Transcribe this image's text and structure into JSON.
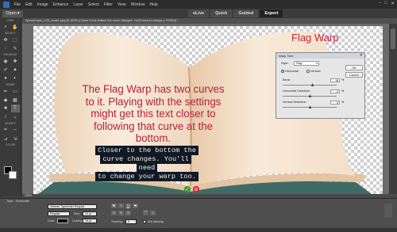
{
  "menu": {
    "items": [
      "File",
      "Edit",
      "Image",
      "Enhance",
      "Layer",
      "Select",
      "Filter",
      "View",
      "Window",
      "Help"
    ]
  },
  "topbar": {
    "open_label": "Open",
    "modes": [
      "eLive",
      "Quick",
      "Guided",
      "Expert"
    ],
    "active_mode": "Expert"
  },
  "toolbar": {
    "sections": [
      "VIEW",
      "SELECT",
      "ENHANCE",
      "DRAW",
      "MODIFY",
      "COLOR"
    ]
  },
  "document": {
    "tab": "SpeakGuyer_LO5_book1.png @ 100% (Closer to the bottom the curve changes. You'll need to change y, RGB/8) *"
  },
  "canvas": {
    "title": "Flag Warp",
    "main_text": "The Flag Warp has two curves to it. Playing with the settings might get this text closer to following that curve at the bottom.",
    "label_lines": [
      "Closer to the bottom the",
      "curve changes. You'll need",
      "to change your warp too."
    ]
  },
  "warp_dialog": {
    "title": "Warp Text",
    "style_label": "Style:",
    "style_value": "Flag",
    "horizontal_label": "Horizontal",
    "vertical_label": "Vertical",
    "orientation": "Horizontal",
    "bend_label": "Bend:",
    "bend_value": "+6",
    "hdist_label": "Horizontal Distortion:",
    "hdist_value": "0",
    "vdist_label": "Vertical Distortion:",
    "vdist_value": "0",
    "percent": "%",
    "ok_label": "OK",
    "cancel_label": "Cancel"
  },
  "status": {
    "zoom": "100%"
  },
  "options": {
    "title": "Type - Horizontal",
    "font": "Veteran Typewriter Regular",
    "style": "Regular",
    "size_label": "Size:",
    "size": "10 pt",
    "color_label": "Color:",
    "leading_label": "Leading:",
    "leading": "16 pt",
    "tracking_label": "Tracking:",
    "tracking": "0",
    "bold": "B",
    "italic": "I",
    "underline": "U",
    "strike": "S",
    "antialias_label": "Anti-aliasing"
  },
  "colors": {
    "red_text": "#b5213a",
    "label_bg": "#101a26"
  }
}
